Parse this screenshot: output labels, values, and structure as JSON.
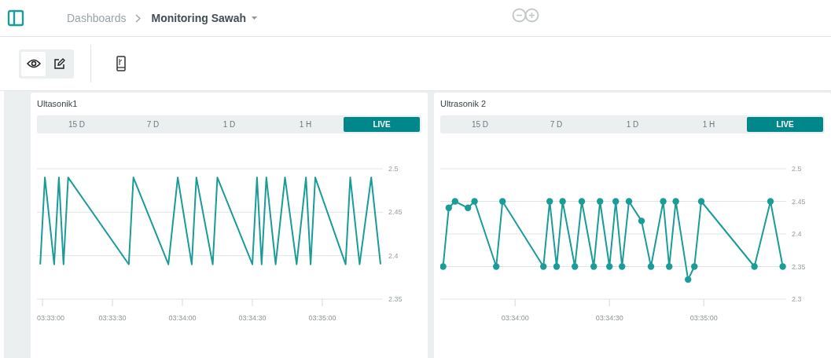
{
  "header": {
    "breadcrumb": "Dashboards",
    "title": "Monitoring Sawah"
  },
  "toolbar": {
    "modes": [
      {
        "kind": "view",
        "selected": true
      },
      {
        "kind": "edit",
        "selected": false
      }
    ]
  },
  "widgets": [
    {
      "title": "Ultasonik1",
      "tabs": [
        {
          "label": "15 D",
          "selected": false
        },
        {
          "label": "7 D",
          "selected": false
        },
        {
          "label": "1 D",
          "selected": false
        },
        {
          "label": "1 H",
          "selected": false
        },
        {
          "label": "LIVE",
          "selected": true
        }
      ],
      "chart_data": {
        "type": "line",
        "grid": true,
        "xlim": [
          12777.6,
          12926
        ],
        "ylim": [
          2.35,
          2.5
        ],
        "xticks": [
          {
            "value": 12780,
            "label": "03:33:00"
          },
          {
            "value": 12810,
            "label": "03:33:30"
          },
          {
            "value": 12840,
            "label": "03:34:00"
          },
          {
            "value": 12870,
            "label": "03:34:30"
          },
          {
            "value": 12900,
            "label": "03:35:00"
          }
        ],
        "yticks": [
          2.5,
          2.45,
          2.4,
          2.35
        ],
        "x": [
          12779,
          12781,
          12785,
          12787,
          12789,
          12791,
          12817,
          12819,
          12834,
          12838,
          12844,
          12846,
          12853,
          12855,
          12870,
          12872,
          12874,
          12876,
          12880,
          12884,
          12889,
          12893,
          12895,
          12897,
          12910,
          12912,
          12916,
          12921,
          12925
        ],
        "series": [
          {
            "color": "#1a9c98",
            "marker": false,
            "values": [
              2.39,
              2.49,
              2.39,
              2.49,
              2.39,
              2.49,
              2.39,
              2.49,
              2.39,
              2.49,
              2.39,
              2.49,
              2.39,
              2.49,
              2.39,
              2.49,
              2.39,
              2.49,
              2.39,
              2.49,
              2.39,
              2.49,
              2.39,
              2.49,
              2.39,
              2.49,
              2.39,
              2.49,
              2.39
            ]
          }
        ]
      }
    },
    {
      "title": "Ultrasonik 2",
      "tabs": [
        {
          "label": "15 D",
          "selected": false
        },
        {
          "label": "7 D",
          "selected": false
        },
        {
          "label": "1 D",
          "selected": false
        },
        {
          "label": "1 H",
          "selected": false
        },
        {
          "label": "LIVE",
          "selected": true
        }
      ],
      "chart_data": {
        "type": "line",
        "grid": true,
        "xlim": [
          12816.2,
          12926.2
        ],
        "ylim": [
          2.3,
          2.5
        ],
        "xticks": [
          {
            "value": 12840,
            "label": "03:34:00"
          },
          {
            "value": 12870,
            "label": "03:34:30"
          },
          {
            "value": 12900,
            "label": "03:35:00"
          }
        ],
        "yticks": [
          2.5,
          2.45,
          2.4,
          2.35,
          2.3
        ],
        "x": [
          12817.1,
          12818.9,
          12820.9,
          12825,
          12827.1,
          12834,
          12836,
          12849,
          12851,
          12853.2,
          12855.1,
          12859,
          12861.2,
          12865,
          12867,
          12870,
          12872,
          12874,
          12876.2,
          12880.2,
          12883.2,
          12887.1,
          12889,
          12891.1,
          12895,
          12897,
          12899.2,
          12916.1,
          12921.2,
          12925.1
        ],
        "series": [
          {
            "color": "#1a9c98",
            "marker": true,
            "values": [
              2.35,
              2.44,
              2.45,
              2.44,
              2.45,
              2.35,
              2.45,
              2.35,
              2.45,
              2.35,
              2.45,
              2.35,
              2.45,
              2.35,
              2.45,
              2.35,
              2.45,
              2.35,
              2.45,
              2.42,
              2.35,
              2.45,
              2.35,
              2.45,
              2.33,
              2.35,
              2.45,
              2.35,
              2.45,
              2.35
            ]
          }
        ]
      }
    }
  ]
}
